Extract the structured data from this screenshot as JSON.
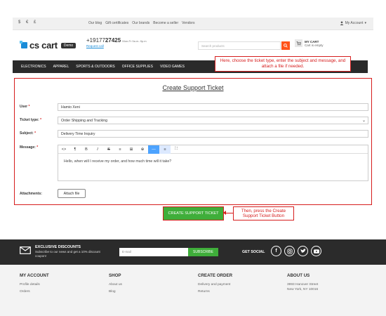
{
  "topbar": {
    "currencies": [
      "$",
      "€",
      "£"
    ],
    "links": [
      "Our blog",
      "Gift certificates",
      "Our brands",
      "Become a seller",
      "Vendors"
    ],
    "account_label": "My Account"
  },
  "header": {
    "logo_text": "cs cart",
    "demo_badge": "Demo",
    "phone_prefix": "+19177",
    "phone_bold": "27425",
    "hours": "Mon-Fr 9a.m.-9p.m",
    "request_call": "Request call",
    "search_placeholder": "Search products",
    "cart_title": "MY CART",
    "cart_status": "Cart is empty"
  },
  "nav": {
    "items": [
      "ELECTRONICS",
      "APPAREL",
      "SPORTS & OUTDOORS",
      "OFFICE SUPPLIES",
      "VIDEO GAMES"
    ]
  },
  "callouts": {
    "top": "Here, choose the ticket type, enter the subject and message, and attach a file if needed.",
    "bottom": "Then, press the Create Support Ticket Button"
  },
  "form": {
    "title": "Create Support Ticket",
    "user_label": "User",
    "user_value": "Hamio Xeni",
    "ticket_type_label": "Ticket type:",
    "ticket_type_value": "Order Shipping and Tracking",
    "subject_label": "Subject:",
    "subject_value": "Delivery Time Inquiry",
    "message_label": "Message:",
    "message_value": "Hello, when will I receive my order, and how much time will it take?",
    "attachments_label": "Attachments:",
    "attach_button": "Attach file",
    "required_mark": "*",
    "toolbar": [
      "<>",
      "¶",
      "B",
      "I",
      "S",
      "≡",
      "⊞",
      "⊕",
      "—",
      "≡",
      "⛶"
    ]
  },
  "submit": {
    "label": "CREATE SUPPORT TICKET"
  },
  "newsletter": {
    "title": "EXCLUSIVE DISCOUNTS",
    "subtitle": "Subscribe to our news and get a 10% discount coupon!",
    "email_placeholder": "E-mail",
    "subscribe": "SUBSCRIBE",
    "get_social": "GET SOCIAL"
  },
  "footer": {
    "col1": {
      "title": "MY ACCOUNT",
      "links": [
        "Profile details",
        "Orders"
      ]
    },
    "col2": {
      "title": "SHOP",
      "links": [
        "About us",
        "Blog"
      ]
    },
    "col3": {
      "title": "CREATE ORDER",
      "links": [
        "Delivery and payment",
        "Returns"
      ]
    },
    "col4": {
      "title": "ABOUT US",
      "links": [
        "3993 Hanover Street",
        "New York, NY 10016"
      ]
    }
  },
  "colors": {
    "accent_green": "#3fae3a",
    "annotation_red": "#d61d1d",
    "search_orange": "#ff5319",
    "nav_dark": "#2a2a2a"
  }
}
